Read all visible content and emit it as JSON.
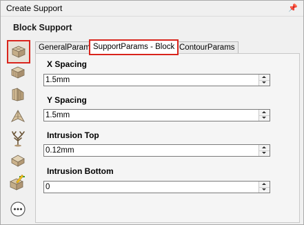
{
  "window": {
    "title": "Create Support"
  },
  "header": {
    "title": "Block Support"
  },
  "toolbar": {
    "items": [
      {
        "name": "block-support-icon",
        "active": true
      },
      {
        "name": "lattice-support-icon",
        "active": false
      },
      {
        "name": "line-support-icon",
        "active": false
      },
      {
        "name": "point-support-icon",
        "active": false
      },
      {
        "name": "tree-support-icon",
        "active": false
      },
      {
        "name": "cone-support-icon",
        "active": false
      },
      {
        "name": "edit-support-icon",
        "active": false
      },
      {
        "name": "more-options-icon",
        "active": false
      }
    ]
  },
  "tabs": [
    {
      "label": "GeneralParams",
      "selected": false
    },
    {
      "label": "SupportParams - Block",
      "selected": true
    },
    {
      "label": "ContourParams",
      "selected": false
    }
  ],
  "fields": {
    "x_spacing": {
      "label": "X Spacing",
      "value": "1.5mm"
    },
    "y_spacing": {
      "label": "Y Spacing",
      "value": "1.5mm"
    },
    "intrusion_top": {
      "label": "Intrusion Top",
      "value": "0.12mm"
    },
    "intrusion_bottom": {
      "label": "Intrusion Bottom",
      "value": "0"
    }
  },
  "colors": {
    "highlight": "#d9241c",
    "background": "#f0f0f0"
  }
}
